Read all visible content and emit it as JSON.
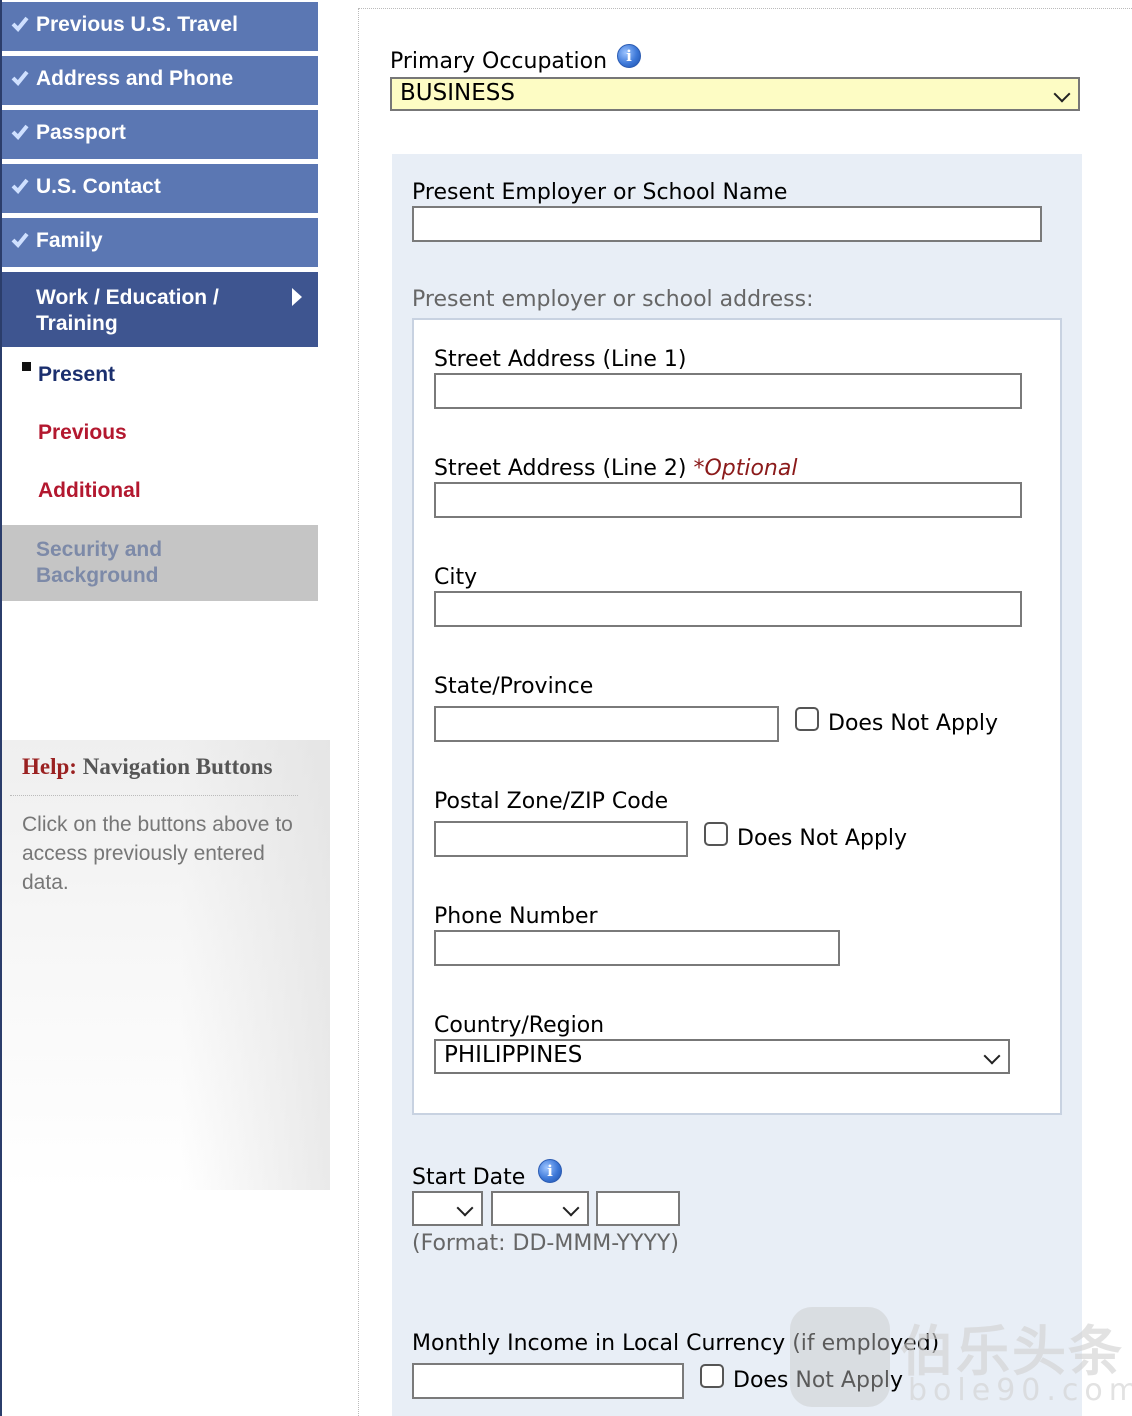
{
  "sidebar": {
    "items": [
      {
        "label": "Previous U.S. Travel"
      },
      {
        "label": "Address and Phone"
      },
      {
        "label": "Passport"
      },
      {
        "label": "U.S. Contact"
      },
      {
        "label": "Family"
      }
    ],
    "active": {
      "label_line1": "Work / Education /",
      "label_line2": "Training"
    },
    "sub_items": {
      "present": "Present",
      "previous": "Previous",
      "additional": "Additional"
    },
    "disabled": {
      "label_line1": "Security and",
      "label_line2": "Background"
    }
  },
  "help": {
    "title_prefix": "Help:",
    "title_rest": " Navigation Buttons",
    "text": "Click on the buttons above to access previously entered data."
  },
  "form": {
    "primary_occupation": {
      "label": "Primary Occupation",
      "value": "BUSINESS"
    },
    "employer_name": {
      "label": "Present Employer or School Name",
      "value": ""
    },
    "address_heading": "Present employer or school address:",
    "street1": {
      "label": "Street Address (Line 1)",
      "value": ""
    },
    "street2": {
      "label": "Street Address (Line 2)",
      "optional": "*Optional",
      "value": ""
    },
    "city": {
      "label": "City",
      "value": ""
    },
    "state": {
      "label": "State/Province",
      "value": "",
      "dna": "Does Not Apply"
    },
    "postal": {
      "label": "Postal Zone/ZIP Code",
      "value": "",
      "dna": "Does Not Apply"
    },
    "phone": {
      "label": "Phone Number",
      "value": ""
    },
    "country": {
      "label": "Country/Region",
      "value": "PHILIPPINES"
    },
    "start_date": {
      "label": "Start Date",
      "day": "",
      "month": "",
      "year": "",
      "format": "(Format: DD-MMM-YYYY)"
    },
    "income": {
      "label": "Monthly Income in Local Currency (if employed)",
      "value": "",
      "dna": "Does Not Apply"
    }
  },
  "watermark": {
    "line1": "伯乐头条",
    "line2": "bole90.com"
  },
  "colors": {
    "nav_blue": "#5b77b3",
    "nav_active": "#3e5590",
    "red_link": "#b3182f",
    "panel_blue": "#e8eef6",
    "highlight_yellow": "#fdfcc4"
  }
}
